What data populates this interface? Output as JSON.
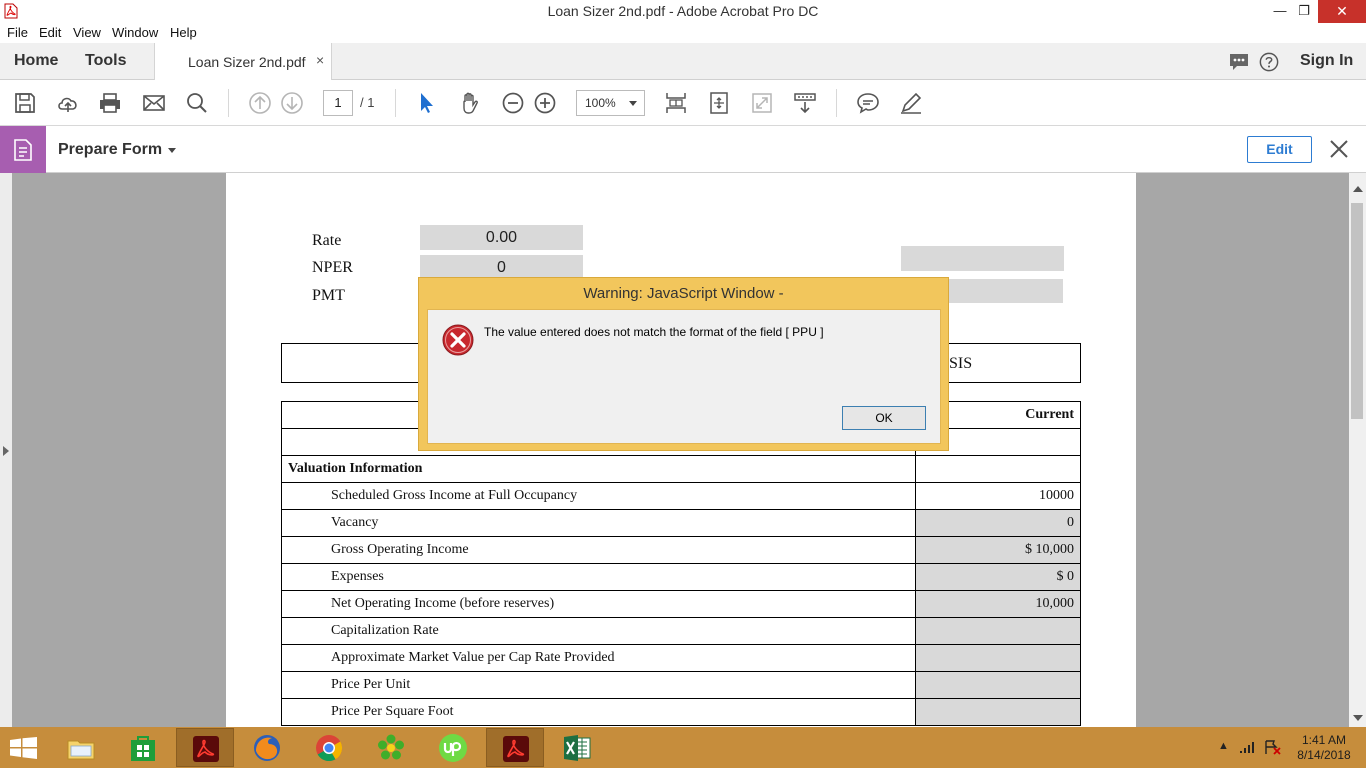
{
  "window": {
    "title": "Loan Sizer 2nd.pdf - Adobe Acrobat Pro DC",
    "controls": {
      "minimize": "—",
      "maximize": "❐",
      "close": "✕"
    }
  },
  "menu": [
    "File",
    "Edit",
    "View",
    "Window",
    "Help"
  ],
  "tabs": {
    "home": "Home",
    "tools": "Tools",
    "document": "Loan Sizer 2nd.pdf",
    "close": "×",
    "sign_in": "Sign In"
  },
  "toolbar": {
    "page_current": "1",
    "page_total": "/ 1",
    "zoom": "100%",
    "icons": [
      "save-icon",
      "cloud-upload-icon",
      "print-icon",
      "mail-icon",
      "search-icon",
      "page-up-icon",
      "page-down-icon",
      "select-arrow-icon",
      "hand-icon",
      "zoom-out-icon",
      "zoom-in-icon",
      "fit-page-icon",
      "full-screen-icon",
      "read-mode-icon",
      "scroll-icon",
      "comment-icon",
      "pen-icon"
    ]
  },
  "form_bar": {
    "label": "Prepare Form",
    "edit": "Edit"
  },
  "document": {
    "rate_label": "Rate",
    "rate_value": "0.00",
    "nper_label": "NPER",
    "nper_value": "0",
    "pmt_label": "PMT",
    "header_tail": "SIS",
    "column_current": "Current",
    "section": "Valuation Information",
    "rows": [
      {
        "label": "Scheduled Gross Income at Full Occupancy",
        "value": "10000",
        "shaded": false
      },
      {
        "label": "Vacancy",
        "value": "0",
        "shaded": true
      },
      {
        "label": "Gross Operating Income",
        "value": "$ 10,000",
        "shaded": true
      },
      {
        "label": "Expenses",
        "value": "$ 0",
        "shaded": true
      },
      {
        "label": "Net Operating Income (before reserves)",
        "value": "10,000",
        "shaded": true
      },
      {
        "label": "Capitalization Rate",
        "value": "",
        "shaded": true
      },
      {
        "label": "Approximate Market Value per Cap Rate Provided",
        "value": "",
        "shaded": true
      },
      {
        "label": "Price Per Unit",
        "value": "",
        "shaded": true
      },
      {
        "label": "Price Per Square Foot",
        "value": "",
        "shaded": true
      }
    ]
  },
  "dialog": {
    "title": "Warning: JavaScript Window -",
    "message": "The value entered does not match the format of the field [ PPU ]",
    "ok": "OK"
  },
  "taskbar": {
    "time": "1:41 AM",
    "date": "8/14/2018"
  },
  "colors": {
    "taskbar": "#c68d3c",
    "dialog_frame": "#f2c65c",
    "form_badge": "#a75eb0",
    "accent_blue": "#2d7cd2",
    "field_gray": "#d9d9d9"
  }
}
